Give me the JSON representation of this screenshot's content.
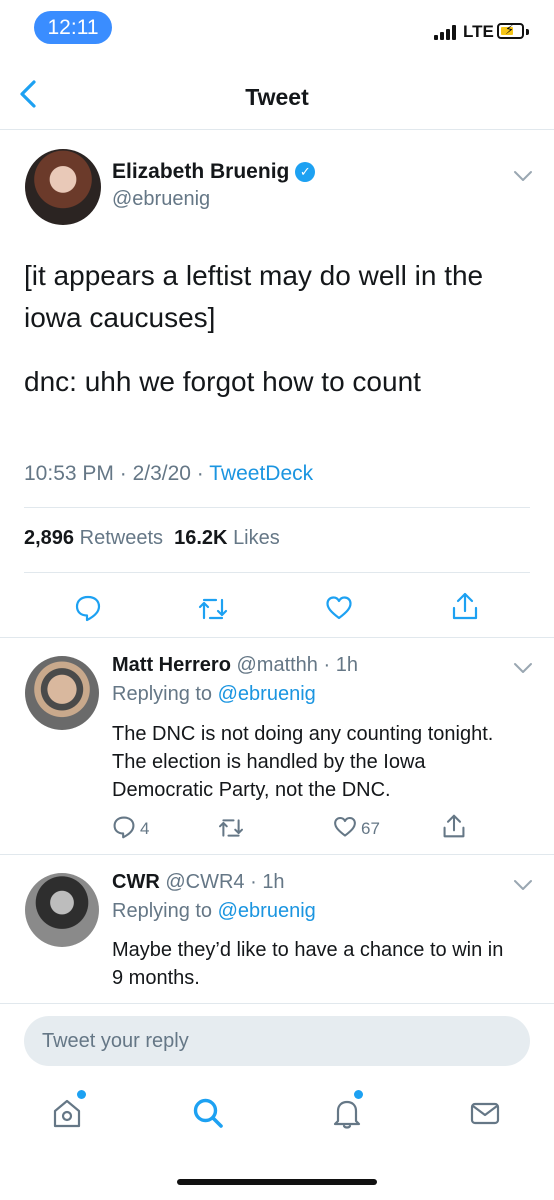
{
  "status_bar": {
    "time": "12:11",
    "network": "LTE"
  },
  "nav": {
    "title": "Tweet"
  },
  "tweet": {
    "author_name": "Elizabeth Bruenig",
    "author_handle": "@ebruenig",
    "text_line1": "[it appears a leftist may do well in the iowa caucuses]",
    "text_line2": "dnc: uhh we forgot how to count",
    "time": "10:53 PM",
    "date": "2/3/20",
    "source": "TweetDeck",
    "retweets_count": "2,896",
    "retweets_label": "Retweets",
    "likes_count": "16.2K",
    "likes_label": "Likes"
  },
  "replies": [
    {
      "name": "Matt Herrero",
      "handle": "@matthh",
      "age": "1h",
      "replying_label": "Replying to",
      "replying_to": "@ebruenig",
      "text": "The DNC is not doing any counting tonight. The election is handled by the Iowa Democratic Party, not the DNC.",
      "reply_count": "4",
      "like_count": "67"
    },
    {
      "name": "CWR",
      "handle": "@CWR4",
      "age": "1h",
      "replying_label": "Replying to",
      "replying_to": "@ebruenig",
      "text": "Maybe they’d like to have a chance to win in 9 months."
    }
  ],
  "reply_box": {
    "placeholder": "Tweet your reply"
  },
  "icons": {
    "back": "chevron-left-icon",
    "caret": "chevron-down-icon",
    "reply": "reply-icon",
    "retweet": "retweet-icon",
    "like": "heart-icon",
    "share": "share-icon",
    "home": "home-icon",
    "search": "search-icon",
    "notifications": "bell-icon",
    "messages": "mail-icon"
  },
  "colors": {
    "accent": "#1da1f2",
    "link": "#1b95e0",
    "secondary_text": "#657786",
    "time_pill": "#3a8dff"
  }
}
